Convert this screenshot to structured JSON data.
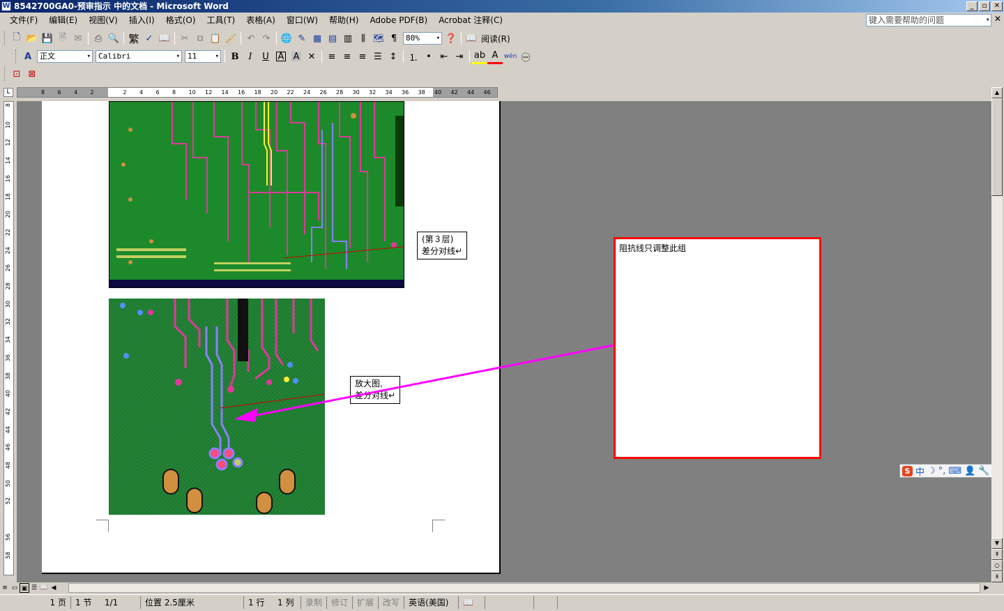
{
  "window": {
    "title": "8542700GA0-预审指示 中的文档 - Microsoft Word",
    "app_icon": "word-document-icon",
    "controls": [
      "_",
      "▫",
      "✕"
    ]
  },
  "menu": {
    "items": [
      "文件(F)",
      "编辑(E)",
      "视图(V)",
      "插入(I)",
      "格式(O)",
      "工具(T)",
      "表格(A)",
      "窗口(W)",
      "帮助(H)",
      "Adobe PDF(B)",
      "Acrobat 注释(C)"
    ],
    "help_placeholder": "键入需要帮助的问题",
    "close": "✕"
  },
  "toolbar_standard": {
    "traditional_label": "繁",
    "zoom": "80%",
    "read_label": "阅读(R)"
  },
  "toolbar_format": {
    "style": "正文",
    "font": "Calibri",
    "size": "11",
    "bold": "B",
    "italic": "I",
    "underline": "U",
    "char_border": "A",
    "char_shade": "A",
    "font_color": "A",
    "wen": "wén"
  },
  "ruler": {
    "h_numbers": [
      "8",
      "6",
      "4",
      "2",
      "",
      "2",
      "4",
      "6",
      "8",
      "10",
      "12",
      "14",
      "16",
      "18",
      "20",
      "22",
      "24",
      "26",
      "28",
      "30",
      "32",
      "34",
      "36",
      "38",
      "40",
      "42",
      "44",
      "46"
    ],
    "v_numbers": [
      "8",
      "10",
      "12",
      "14",
      "16",
      "18",
      "20",
      "22",
      "24",
      "26",
      "28",
      "30",
      "32",
      "34",
      "36",
      "38",
      "40",
      "42",
      "44",
      "46",
      "48",
      "50",
      "52",
      "",
      "56",
      "58"
    ]
  },
  "document": {
    "callout1_line1": "(第３层)",
    "callout1_line2": "差分对线↵",
    "callout2_line1": "放大图,",
    "callout2_line2": "差分对线↵",
    "note_box_text": "阻抗线只调整此组",
    "colors": {
      "pcb_green": "#1c8a2a",
      "trace_pink": "#e0389c",
      "arrow_magenta": "#ff00ff",
      "box_red": "#ff0000"
    }
  },
  "ime": {
    "logo": "S",
    "mode": "中"
  },
  "status": {
    "page": "1 页",
    "section": "1 节",
    "page_of": "1/1",
    "position": "位置 2.5厘米",
    "line": "1 行",
    "column": "1 列",
    "rec": "录制",
    "trk": "修订",
    "ext": "扩展",
    "ovr": "改写",
    "language": "英语(美国)"
  }
}
